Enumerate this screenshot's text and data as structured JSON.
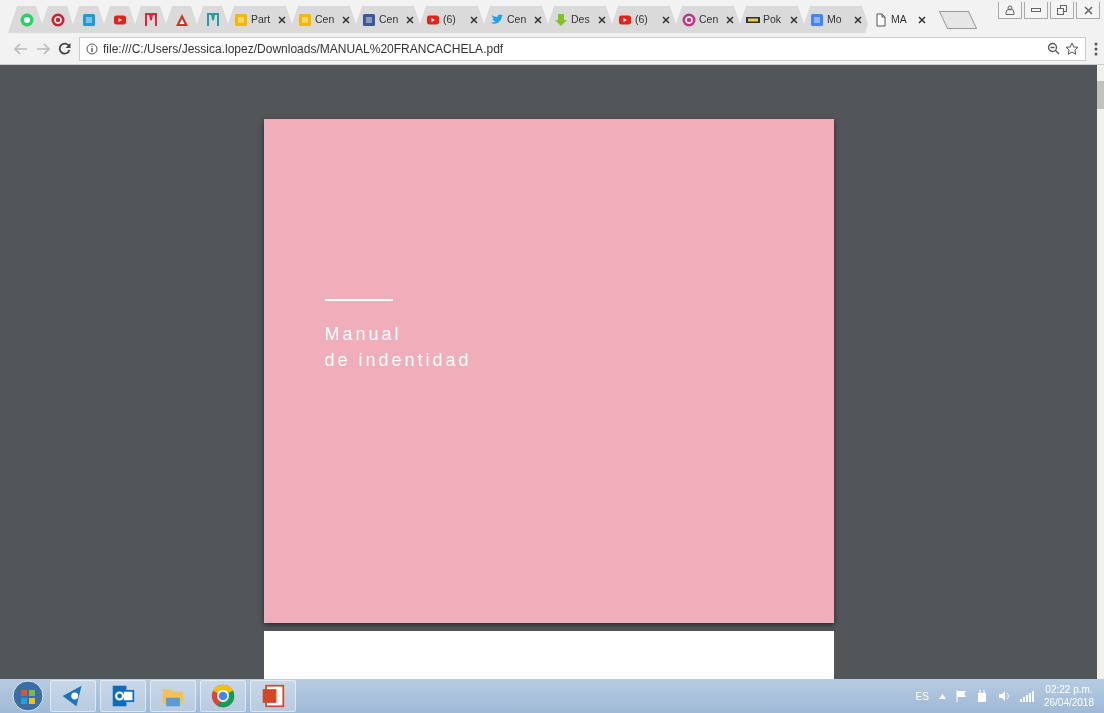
{
  "tabs": [
    {
      "kind": "chat",
      "selected": false
    },
    {
      "kind": "target",
      "selected": false
    },
    {
      "kind": "tile",
      "selected": false
    },
    {
      "kind": "video",
      "selected": false
    },
    {
      "kind": "letter",
      "selected": false
    },
    {
      "kind": "triangle",
      "selected": false
    },
    {
      "kind": "letter2",
      "selected": false
    },
    {
      "title": "Part",
      "kind": "badge",
      "selected": false
    },
    {
      "title": "Cen",
      "kind": "badge",
      "selected": false
    },
    {
      "title": "Cen",
      "kind": "tile2",
      "selected": false
    },
    {
      "title": "(6)",
      "kind": "video",
      "selected": false
    },
    {
      "title": "Cen",
      "kind": "bird",
      "selected": false
    },
    {
      "title": "Des",
      "kind": "download",
      "selected": false
    },
    {
      "title": "(6)",
      "kind": "video",
      "selected": false
    },
    {
      "title": "Cen",
      "kind": "camera",
      "selected": false
    },
    {
      "title": "Pok",
      "kind": "bars",
      "selected": false
    },
    {
      "title": "Mo",
      "kind": "notes",
      "selected": false
    },
    {
      "title": "MA",
      "kind": "doc",
      "selected": true
    }
  ],
  "address": "file:///C:/Users/Jessica.lopez/Downloads/MANUAL%20FRANCACHELA.pdf",
  "pdf_page": {
    "title_lines": [
      "Manual",
      "de indentidad"
    ]
  },
  "taskbar": {
    "apps": [
      {
        "kind": "pin"
      },
      {
        "kind": "mail"
      },
      {
        "kind": "folder"
      },
      {
        "kind": "wheel"
      },
      {
        "kind": "slides"
      }
    ],
    "language": "ES",
    "time": "02:22 p.m.",
    "date": "26/04/2018"
  }
}
